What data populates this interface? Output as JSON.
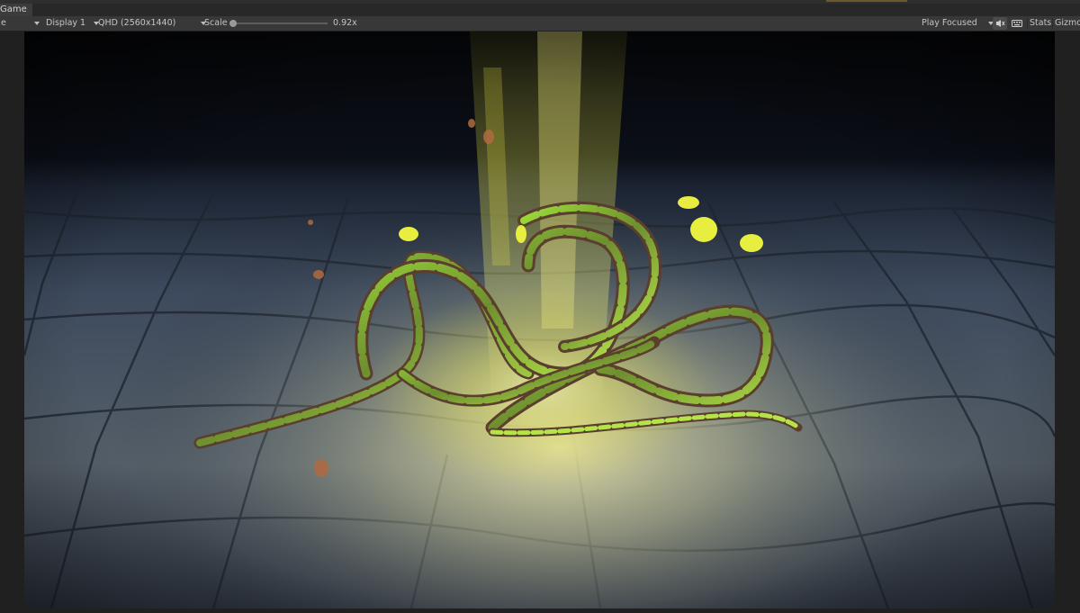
{
  "tab": {
    "label": "Game"
  },
  "toolbar": {
    "mode_label": "e",
    "display_label": "Display 1",
    "resolution_label": "QHD (2560x1440)",
    "scale_label": "Scale",
    "scale_value": "0.92x",
    "scale_fraction": 0.0,
    "play_mode_label": "Play Focused",
    "stats_label": "Stats",
    "gizmos_label": "Gizmos"
  },
  "icons": [
    "caret-down-icon",
    "mute-audio-icon",
    "keyboard-icon",
    "slider-thumb"
  ],
  "colors": {
    "editor_bg": "#383838",
    "tab_bg": "#3c3c3c",
    "glow": "#e6ea3c",
    "vine_green": "#8fd13a",
    "vine_bark": "#6b4a35"
  }
}
